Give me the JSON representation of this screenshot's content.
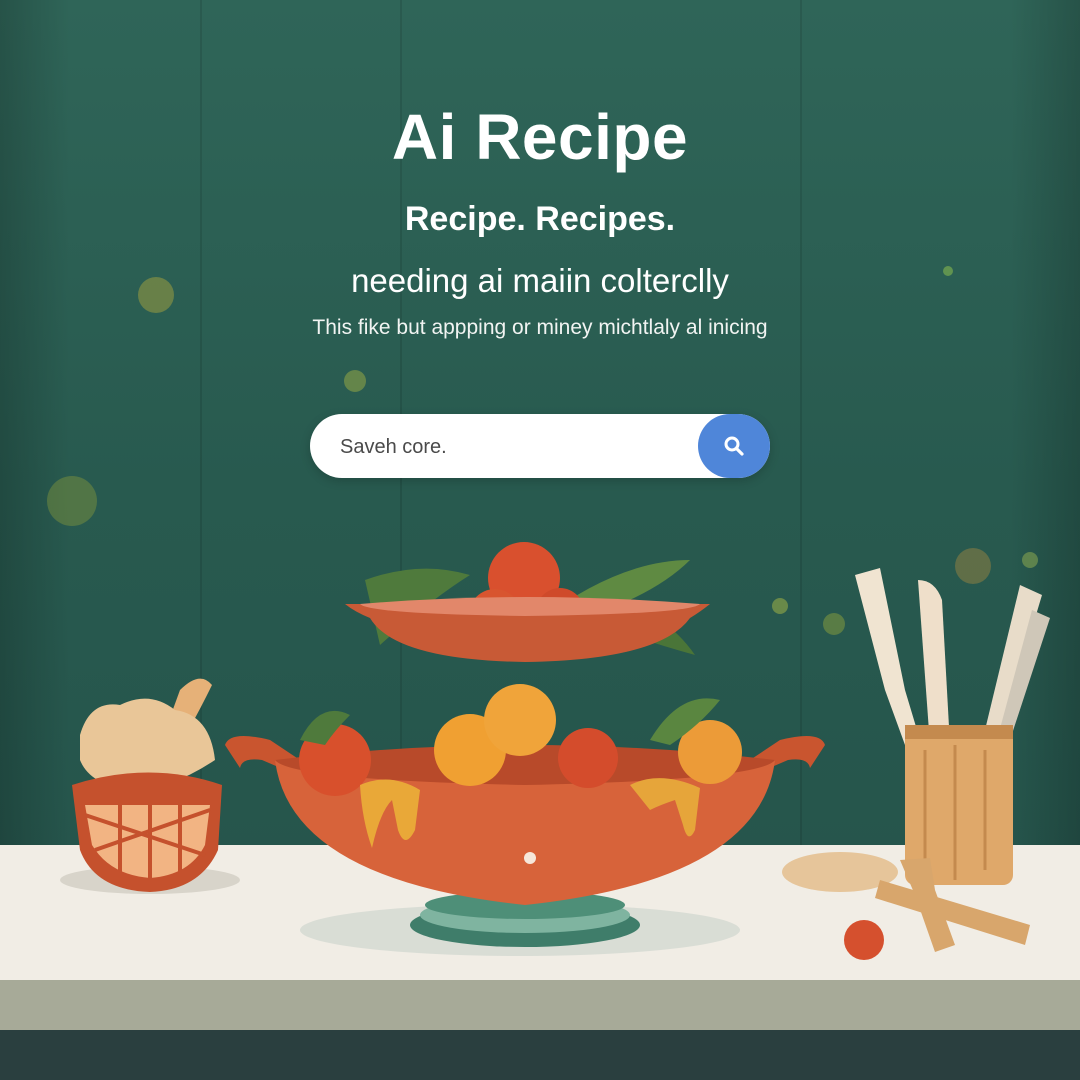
{
  "hero": {
    "title": "Ai Recipe",
    "subtitle": "Recipe. Recipes.",
    "tagline": "needing ai maiin colterclly",
    "description": "This fike but appping or miney michtlaly al inicing"
  },
  "search": {
    "placeholder": "Saveh core.",
    "button_icon": "search-icon"
  },
  "colors": {
    "background": "#2a5a4f",
    "accent": "#4f86d9",
    "pot": "#d9663f",
    "counter": "#f1ede5"
  }
}
